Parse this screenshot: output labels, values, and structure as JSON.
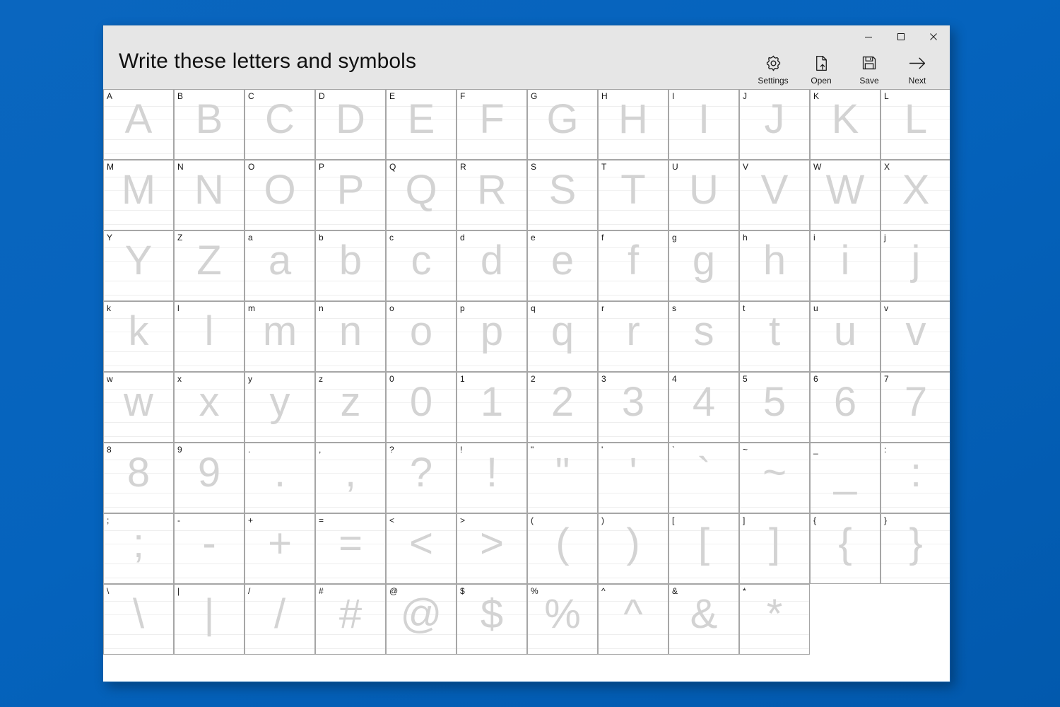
{
  "window": {
    "title": "Write these letters and symbols",
    "accent_color": "#0563bd",
    "header_color": "#e6e6e6",
    "body_color": "#ffffff",
    "ghost_color": "#d3d3d3",
    "rule_color": "#eeeeee",
    "controls": [
      {
        "name": "minimize",
        "glyph": "─"
      },
      {
        "name": "maximize",
        "glyph": "□"
      },
      {
        "name": "close",
        "glyph": "✕"
      }
    ]
  },
  "toolbar": {
    "settings_label": "Settings",
    "open_label": "Open",
    "save_label": "Save",
    "next_label": "Next",
    "icons": {
      "settings": "gear-icon",
      "open": "document-open-icon",
      "save": "floppy-disk-icon",
      "next": "arrow-right-icon"
    }
  },
  "worksheet": {
    "columns": 12,
    "rows": 8,
    "total_cells": 94,
    "cells": [
      "A",
      "B",
      "C",
      "D",
      "E",
      "F",
      "G",
      "H",
      "I",
      "J",
      "K",
      "L",
      "M",
      "N",
      "O",
      "P",
      "Q",
      "R",
      "S",
      "T",
      "U",
      "V",
      "W",
      "X",
      "Y",
      "Z",
      "a",
      "b",
      "c",
      "d",
      "e",
      "f",
      "g",
      "h",
      "i",
      "j",
      "k",
      "l",
      "m",
      "n",
      "o",
      "p",
      "q",
      "r",
      "s",
      "t",
      "u",
      "v",
      "w",
      "x",
      "y",
      "z",
      "0",
      "1",
      "2",
      "3",
      "4",
      "5",
      "6",
      "7",
      "8",
      "9",
      ".",
      ",",
      "?",
      "!",
      "\"",
      "'",
      "`",
      "~",
      "_",
      ":",
      ";",
      "-",
      "+",
      "=",
      "<",
      ">",
      "(",
      ")",
      "[",
      "]",
      "{",
      "}",
      "\\",
      "|",
      "/",
      "#",
      "@",
      "$",
      "%",
      "^",
      "&",
      "*"
    ]
  }
}
